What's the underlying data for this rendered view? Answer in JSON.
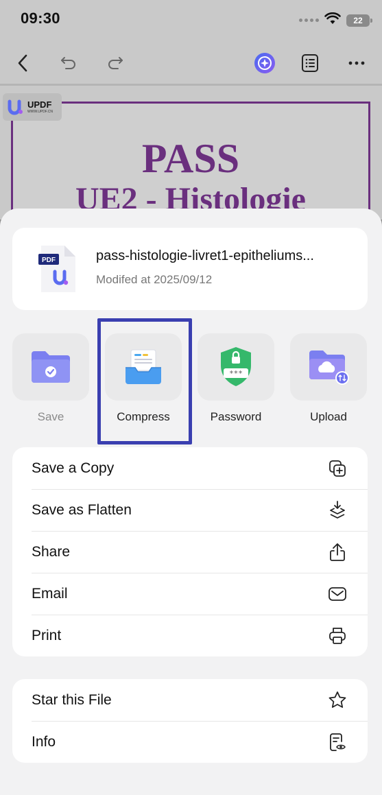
{
  "status": {
    "time": "09:30",
    "battery": "22"
  },
  "document": {
    "title_line1": "PASS",
    "title_line2": "UE2 - Histologie",
    "watermark_name": "UPDF",
    "watermark_url": "WWW.UPDF.CN"
  },
  "file": {
    "badge": "PDF",
    "name": "pass-histologie-livret1-epitheliums...",
    "modified": "Modifed at 2025/09/12"
  },
  "actions": [
    {
      "label": "Save",
      "icon": "save-folder-icon",
      "enabled": false
    },
    {
      "label": "Compress",
      "icon": "compress-tray-icon",
      "enabled": true,
      "highlighted": true
    },
    {
      "label": "Password",
      "icon": "password-shield-icon",
      "enabled": true
    },
    {
      "label": "Upload",
      "icon": "cloud-upload-folder-icon",
      "enabled": true
    }
  ],
  "menu": [
    {
      "label": "Save a Copy",
      "icon": "copy-icon"
    },
    {
      "label": "Save as Flatten",
      "icon": "flatten-layers-icon"
    },
    {
      "label": "Share",
      "icon": "share-icon"
    },
    {
      "label": "Email",
      "icon": "mail-icon"
    },
    {
      "label": "Print",
      "icon": "printer-icon"
    }
  ],
  "menu2": [
    {
      "label": "Star this File",
      "icon": "star-icon"
    },
    {
      "label": "Info",
      "icon": "file-info-icon"
    }
  ],
  "colors": {
    "accent_highlight": "#3a3fb0",
    "doc_title": "#6a2f7e",
    "folder_purple": "#7b7ff0",
    "shield_green": "#35b86b"
  }
}
